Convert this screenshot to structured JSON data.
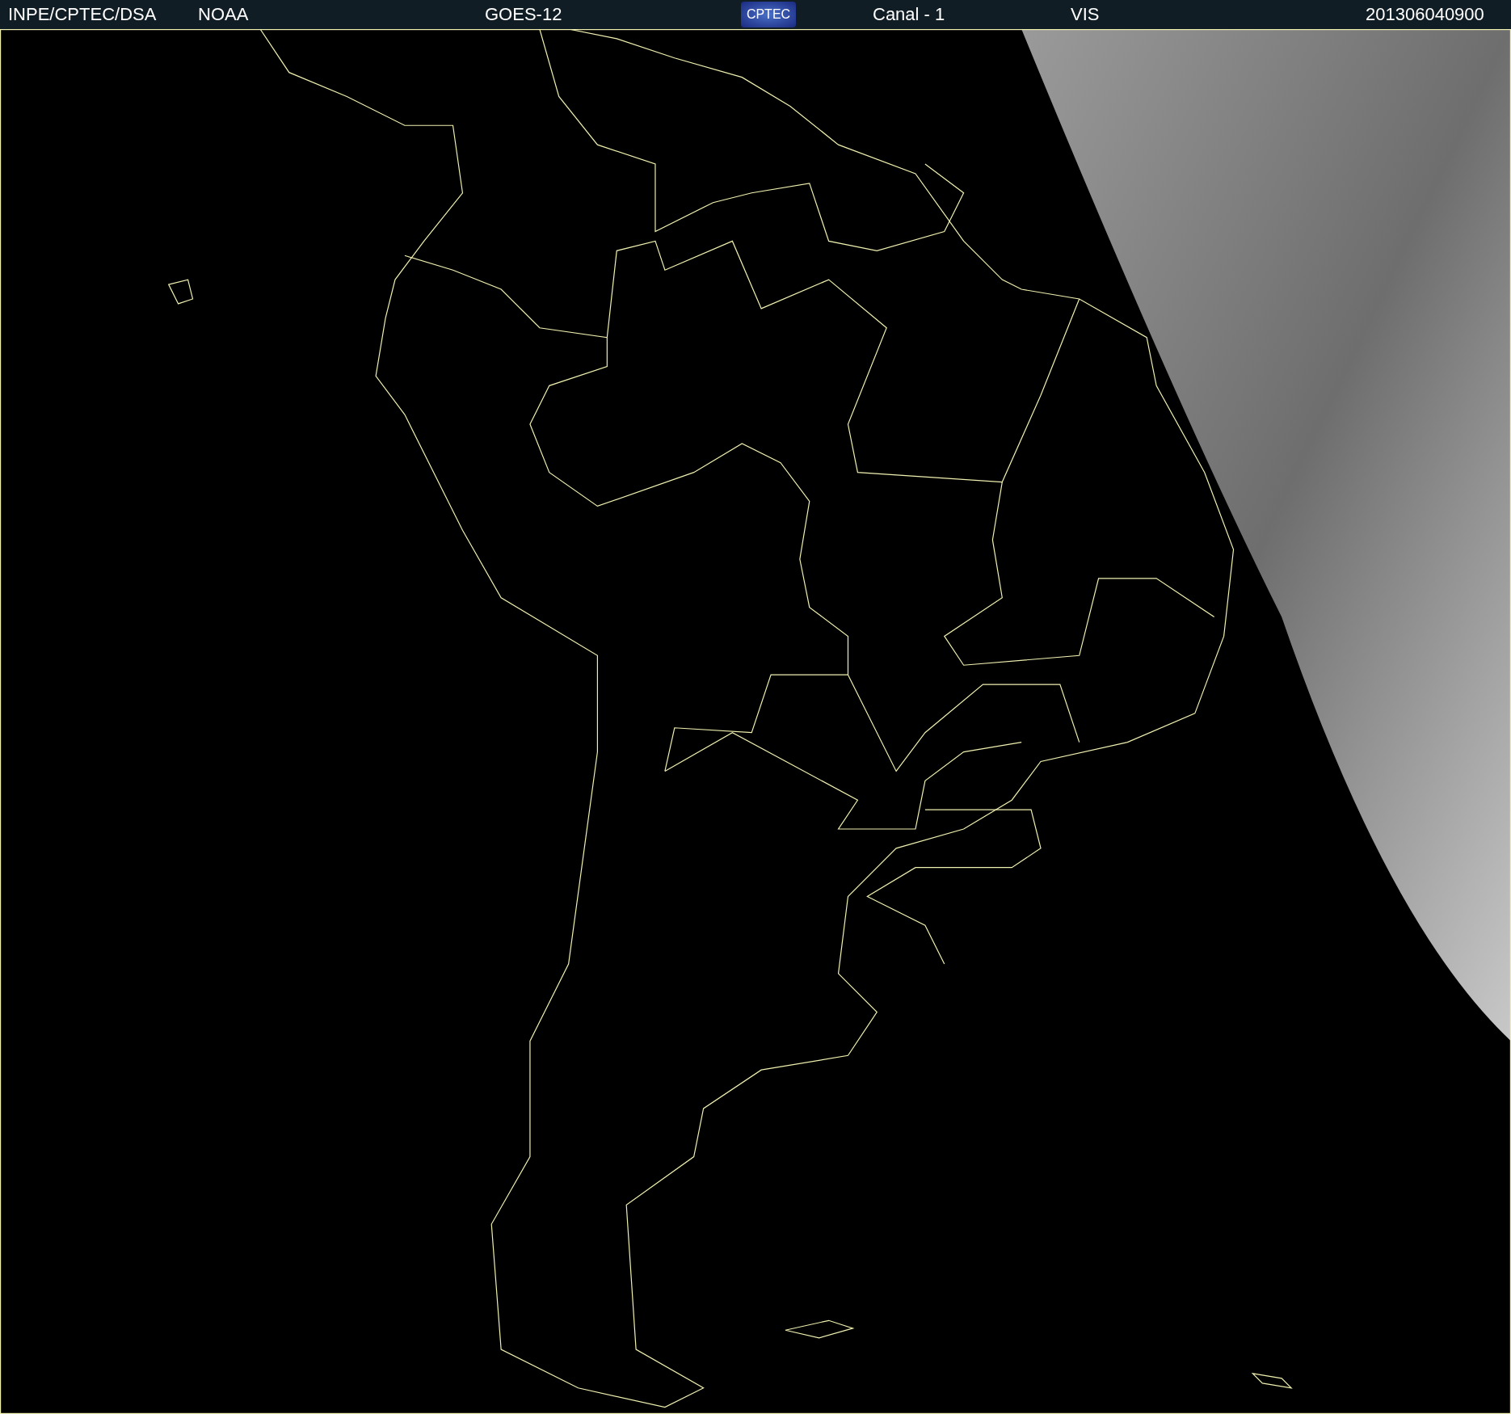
{
  "header": {
    "items": [
      {
        "kind": "text",
        "text": "INPE/CPTEC/DSA"
      },
      {
        "kind": "text",
        "text": "NOAA"
      },
      {
        "kind": "text",
        "text": "GOES-12"
      },
      {
        "kind": "logo",
        "text": "CPTEC"
      },
      {
        "kind": "text",
        "text": "Canal - 1"
      },
      {
        "kind": "text",
        "text": "VIS"
      },
      {
        "kind": "text",
        "text": "201306040900"
      }
    ]
  }
}
